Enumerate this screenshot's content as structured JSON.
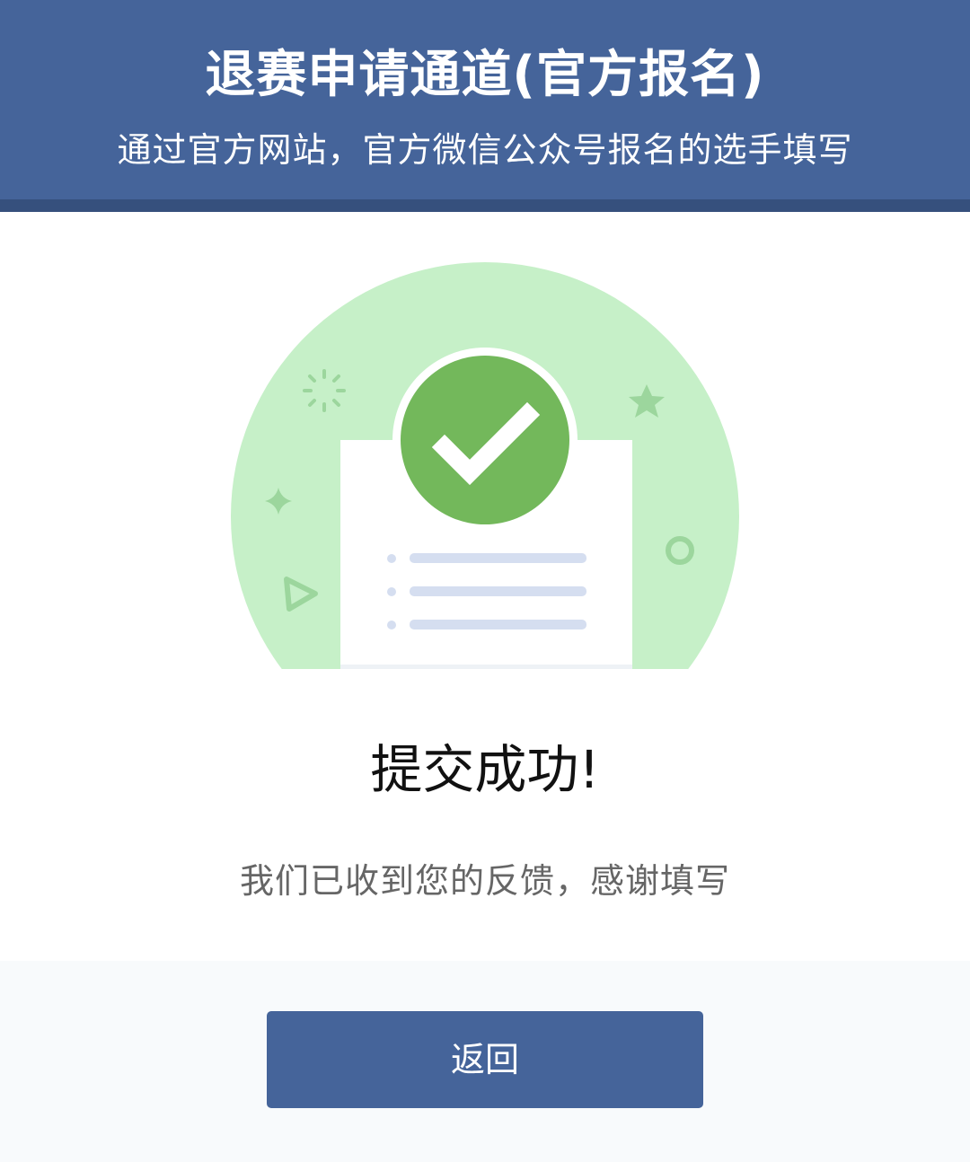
{
  "header": {
    "title": "退赛申请通道(官方报名)",
    "subtitle": "通过官方网站，官方微信公众号报名的选手填写"
  },
  "illustration": {
    "icon": "success-document-check-icon"
  },
  "result": {
    "title": "提交成功!",
    "message": "我们已收到您的反馈，感谢填写"
  },
  "actions": {
    "back_label": "返回"
  },
  "colors": {
    "primary": "#45649a",
    "success_green": "#73b85b",
    "light_green": "#c6f0c8"
  }
}
